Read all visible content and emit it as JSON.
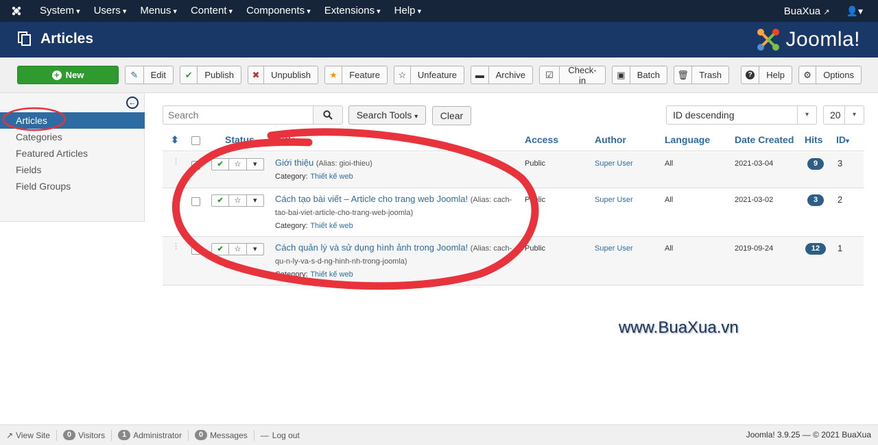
{
  "topnav": {
    "menu": [
      "System",
      "Users",
      "Menus",
      "Content",
      "Components",
      "Extensions",
      "Help"
    ],
    "site_link": "BuaXua"
  },
  "header": {
    "title": "Articles",
    "brand": "Joomla!"
  },
  "toolbar": {
    "new": "New",
    "edit": "Edit",
    "publish": "Publish",
    "unpublish": "Unpublish",
    "feature": "Feature",
    "unfeature": "Unfeature",
    "archive": "Archive",
    "checkin": "Check-in",
    "batch": "Batch",
    "trash": "Trash",
    "help": "Help",
    "options": "Options"
  },
  "sidebar": {
    "items": [
      "Articles",
      "Categories",
      "Featured Articles",
      "Fields",
      "Field Groups"
    ]
  },
  "filters": {
    "search_placeholder": "Search",
    "search_tools": "Search Tools",
    "clear": "Clear",
    "sort": "ID descending",
    "limit": "20"
  },
  "table": {
    "headers": {
      "status": "Status",
      "title": "Title",
      "access": "Access",
      "author": "Author",
      "language": "Language",
      "date_created": "Date Created",
      "hits": "Hits",
      "id": "ID"
    },
    "rows": [
      {
        "title": "Giới thiệu",
        "alias": "(Alias: gioi-thieu)",
        "category_label": "Category:",
        "category": "Thiết kế web",
        "access": "Public",
        "author": "Super User",
        "language": "All",
        "date": "2021-03-04",
        "hits": "9",
        "id": "3"
      },
      {
        "title": "Cách tạo bài viết – Article cho trang web Joomla!",
        "alias": "(Alias: cach-tao-bai-viet-article-cho-trang-web-joomla)",
        "category_label": "Category:",
        "category": "Thiết kế web",
        "access": "Public",
        "author": "Super User",
        "language": "All",
        "date": "2021-03-02",
        "hits": "3",
        "id": "2"
      },
      {
        "title": "Cách quản lý và sử dụng hình ảnh trong Joomla!",
        "alias": "(Alias: cach-qu-n-ly-va-s-d-ng-hinh-nh-trong-joomla)",
        "category_label": "Category:",
        "category": "Thiết kế web",
        "access": "Public",
        "author": "Super User",
        "language": "All",
        "date": "2019-09-24",
        "hits": "12",
        "id": "1"
      }
    ]
  },
  "watermark": "www.BuaXua.vn",
  "footer": {
    "view_site": "View Site",
    "visitors_count": "0",
    "visitors": "Visitors",
    "admin_count": "1",
    "admin": "Administrator",
    "messages_count": "0",
    "messages": "Messages",
    "logout": "Log out",
    "version": "Joomla! 3.9.25 — © 2021 BuaXua"
  },
  "colors": {
    "topnav": "#17253a",
    "header": "#1a3867",
    "accent": "#2d6ca2",
    "new_button": "#2f9b2f",
    "annotation": "#e8323c"
  }
}
